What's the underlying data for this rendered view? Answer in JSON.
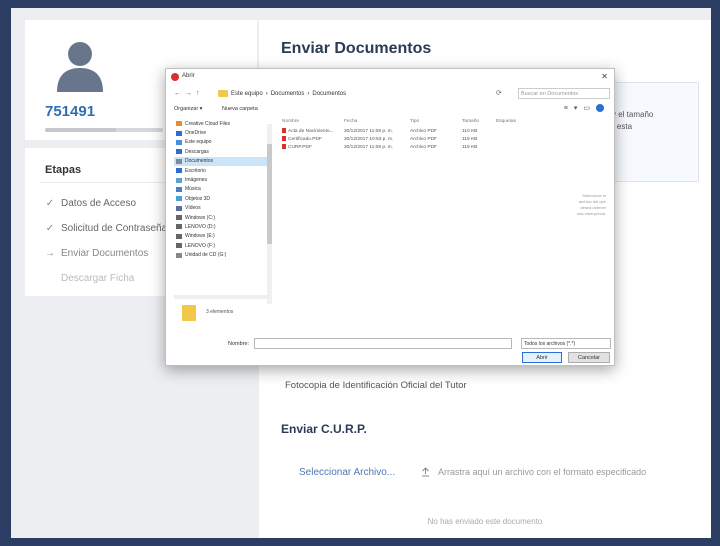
{
  "profile": {
    "user_id": "751491",
    "progress": 0.6
  },
  "steps": {
    "title": "Etapas",
    "items": [
      {
        "label": "Datos de Acceso",
        "mark": "✓",
        "state": "done"
      },
      {
        "label": "Solicitud de Contraseña",
        "mark": "✓",
        "state": "done"
      },
      {
        "label": "Enviar Documentos",
        "mark": "→",
        "state": "current"
      },
      {
        "label": "Descargar Ficha",
        "mark": "",
        "state": "pending"
      }
    ]
  },
  "main": {
    "title": "Enviar Documentos",
    "info_text": ", jpg) y el tamaño\ndo por esta",
    "doc_label": "Fotocopia de Identificación Oficial del Tutor",
    "section_title": "Enviar C.U.R.P.",
    "select_link": "Seleccionar Archivo...",
    "drop_hint": "Arrastra aquí un archivo con el formato especificado",
    "no_doc": "No has enviado este documento"
  },
  "dialog": {
    "title": "Abrir",
    "path": [
      "Este equipo",
      "Documentos",
      "Documentos"
    ],
    "search_placeholder": "Buscar en Documentos",
    "organize": "Organizar ▾",
    "new_folder": "Nueva carpeta",
    "nav_items": [
      {
        "label": "Creative Cloud Files",
        "icon": "cloud-icon"
      },
      {
        "label": "OneDrive",
        "icon": "onedrive-icon"
      },
      {
        "label": "Este equipo",
        "icon": "computer-icon"
      },
      {
        "label": "Descargas",
        "icon": "download-icon"
      },
      {
        "label": "Documentos",
        "icon": "documents-icon",
        "selected": true
      },
      {
        "label": "Escritorio",
        "icon": "desktop-icon"
      },
      {
        "label": "Imágenes",
        "icon": "pictures-icon"
      },
      {
        "label": "Música",
        "icon": "music-icon"
      },
      {
        "label": "Objetos 3D",
        "icon": "3d-icon"
      },
      {
        "label": "Vídeos",
        "icon": "video-icon"
      },
      {
        "label": "Windows (C:)",
        "icon": "drive-icon"
      },
      {
        "label": "LENOVO (D:)",
        "icon": "drive-icon"
      },
      {
        "label": "Windows (E:)",
        "icon": "drive-icon"
      },
      {
        "label": "LENOVO (F:)",
        "icon": "drive-icon"
      },
      {
        "label": "Unidad de CD (G:)",
        "icon": "cd-icon"
      }
    ],
    "columns": [
      "Nombre",
      "Fecha",
      "Tipo",
      "Tamaño",
      "Etiquetas"
    ],
    "files": [
      {
        "name": "Acta de Nacimiento...",
        "date": "30/12/2017 11:08 p. m.",
        "type": "Archivo PDF",
        "size": "110 KB"
      },
      {
        "name": "Certificado.PDF",
        "date": "30/12/2017 10:53 p. m.",
        "type": "Archivo PDF",
        "size": "119 KB"
      },
      {
        "name": "CURP.PDF",
        "date": "30/12/2017 11:08 p. m.",
        "type": "Archivo PDF",
        "size": "119 KB"
      }
    ],
    "preview_text": "Seleccione el archivo del que desea obtener una vista previa.",
    "folder_count": "3 elementos",
    "name_label": "Nombre:",
    "file_type": "Todos los archivos (*.*)",
    "open_button": "Abrir",
    "cancel_button": "Cancelar",
    "colors": {
      "accent": "#2a6fd6",
      "folder": "#f2c84b",
      "pdf": "#d9302c"
    }
  }
}
